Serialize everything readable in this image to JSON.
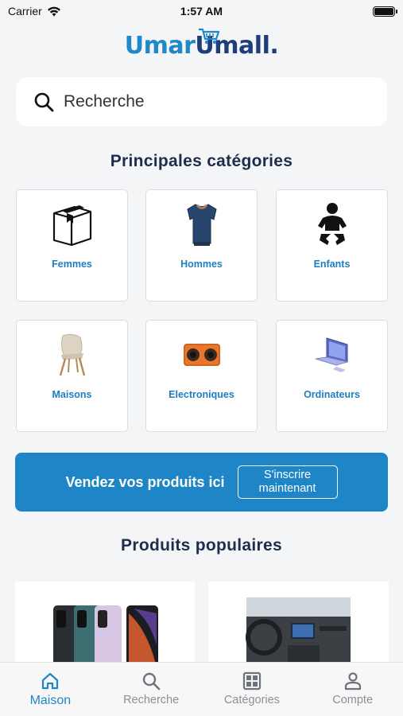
{
  "status_bar": {
    "carrier": "Carrier",
    "time": "1:57 AM"
  },
  "logo": {
    "part1": "Umar",
    "part2": "Umall."
  },
  "search": {
    "placeholder": "Recherche"
  },
  "categories_section": {
    "title": "Principales catégories",
    "items": [
      {
        "label": "Femmes",
        "icon": "box-icon"
      },
      {
        "label": "Hommes",
        "icon": "tshirt-icon"
      },
      {
        "label": "Enfants",
        "icon": "baby-icon"
      },
      {
        "label": "Maisons",
        "icon": "chair-icon"
      },
      {
        "label": "Electroniques",
        "icon": "speaker-icon"
      },
      {
        "label": "Ordinateurs",
        "icon": "laptop-icon"
      }
    ]
  },
  "banner": {
    "text": "Vendez vos produits ici",
    "button_line1": "S'inscrire",
    "button_line2": "maintenant"
  },
  "popular_section": {
    "title": "Produits populaires"
  },
  "bottom_nav": {
    "items": [
      {
        "label": "Maison",
        "icon": "home-icon",
        "active": true
      },
      {
        "label": "Recherche",
        "icon": "search-icon",
        "active": false
      },
      {
        "label": "Catégories",
        "icon": "grid-icon",
        "active": false
      },
      {
        "label": "Compte",
        "icon": "user-icon",
        "active": false
      }
    ]
  },
  "colors": {
    "accent": "#1e86c6",
    "title": "#1f2d4d",
    "background": "#f4f5f7"
  }
}
